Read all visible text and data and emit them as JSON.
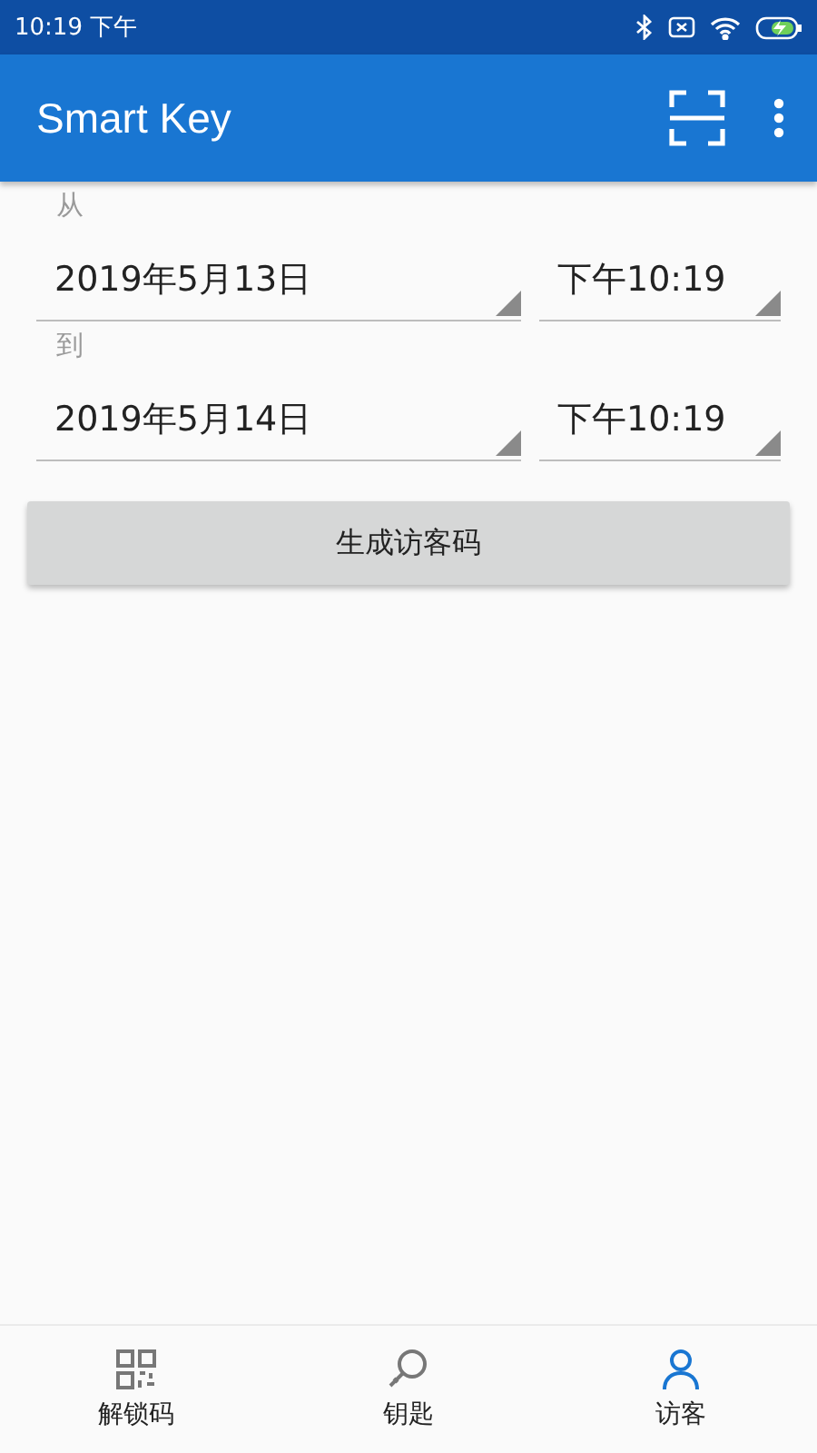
{
  "status_bar": {
    "time": "10:19 下午"
  },
  "app_bar": {
    "title": "Smart Key"
  },
  "ranges": [
    {
      "label": "从",
      "date": "2019年5月13日",
      "time": "下午10:19"
    },
    {
      "label": "到",
      "date": "2019年5月14日",
      "time": "下午10:19"
    }
  ],
  "generate_button": {
    "label": "生成访客码"
  },
  "bottom_nav": [
    {
      "label": "解锁码",
      "kind": "qr",
      "selected": false
    },
    {
      "label": "钥匙",
      "kind": "key",
      "selected": false
    },
    {
      "label": "访客",
      "kind": "person",
      "selected": true
    }
  ]
}
